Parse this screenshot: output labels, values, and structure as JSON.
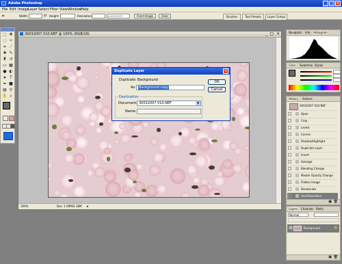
{
  "app": {
    "title": "Adobe Photoshop"
  },
  "menu": [
    "File",
    "Edit",
    "Image",
    "Layer",
    "Select",
    "Filter",
    "View",
    "Window",
    "Help"
  ],
  "options": {
    "width_label": "Width:",
    "height_label": "Height:",
    "resolution_label": "Resolution:",
    "resolution_unit": "pixels/inch",
    "front_image": "Front Image",
    "clear": "Clear"
  },
  "palette_well": [
    "Brushes",
    "Tool Presets",
    "Layer Comps"
  ],
  "document": {
    "title": "30032007 010.NEF @ 100% (RGB/16)",
    "zoom": "100%",
    "doc_info": "Doc: 1.09M/2.18M"
  },
  "dialog": {
    "title": "Duplicate Layer",
    "duplicate_label": "Duplicate:",
    "duplicate_value": "Background",
    "as_label": "As:",
    "as_value": "Background copy",
    "destination_label": "Destination",
    "document_label": "Document:",
    "document_value": "30032007 010.NEF",
    "name_label": "Name:",
    "name_value": "",
    "ok": "OK",
    "cancel": "Cancel"
  },
  "navigator": {
    "tabs": [
      "Navigator",
      "Info",
      "Histogram"
    ]
  },
  "color": {
    "tabs": [
      "Color",
      "Swatches",
      "Styles"
    ]
  },
  "history": {
    "tabs": [
      "History",
      "Actions"
    ],
    "snapshot": "30032007 010.NEF",
    "items": [
      "Open",
      "Crop",
      "Levels",
      "Curves",
      "Shadow/Highlight",
      "Duplicate Layer",
      "Invert",
      "Average",
      "Blending Change",
      "Master Opacity Change",
      "Flatten Image",
      "Desaturate",
      "Hue/Saturation"
    ],
    "selected_index": 12
  },
  "layers": {
    "tabs": [
      "Layers",
      "Channels",
      "Paths"
    ],
    "blend_mode": "Normal",
    "layer_name": "Background"
  },
  "colors": {
    "titlebar": "#0a3cb8",
    "chrome": "#ece9d8",
    "workspace": "#808080",
    "blossom": "#f3e1e4"
  }
}
